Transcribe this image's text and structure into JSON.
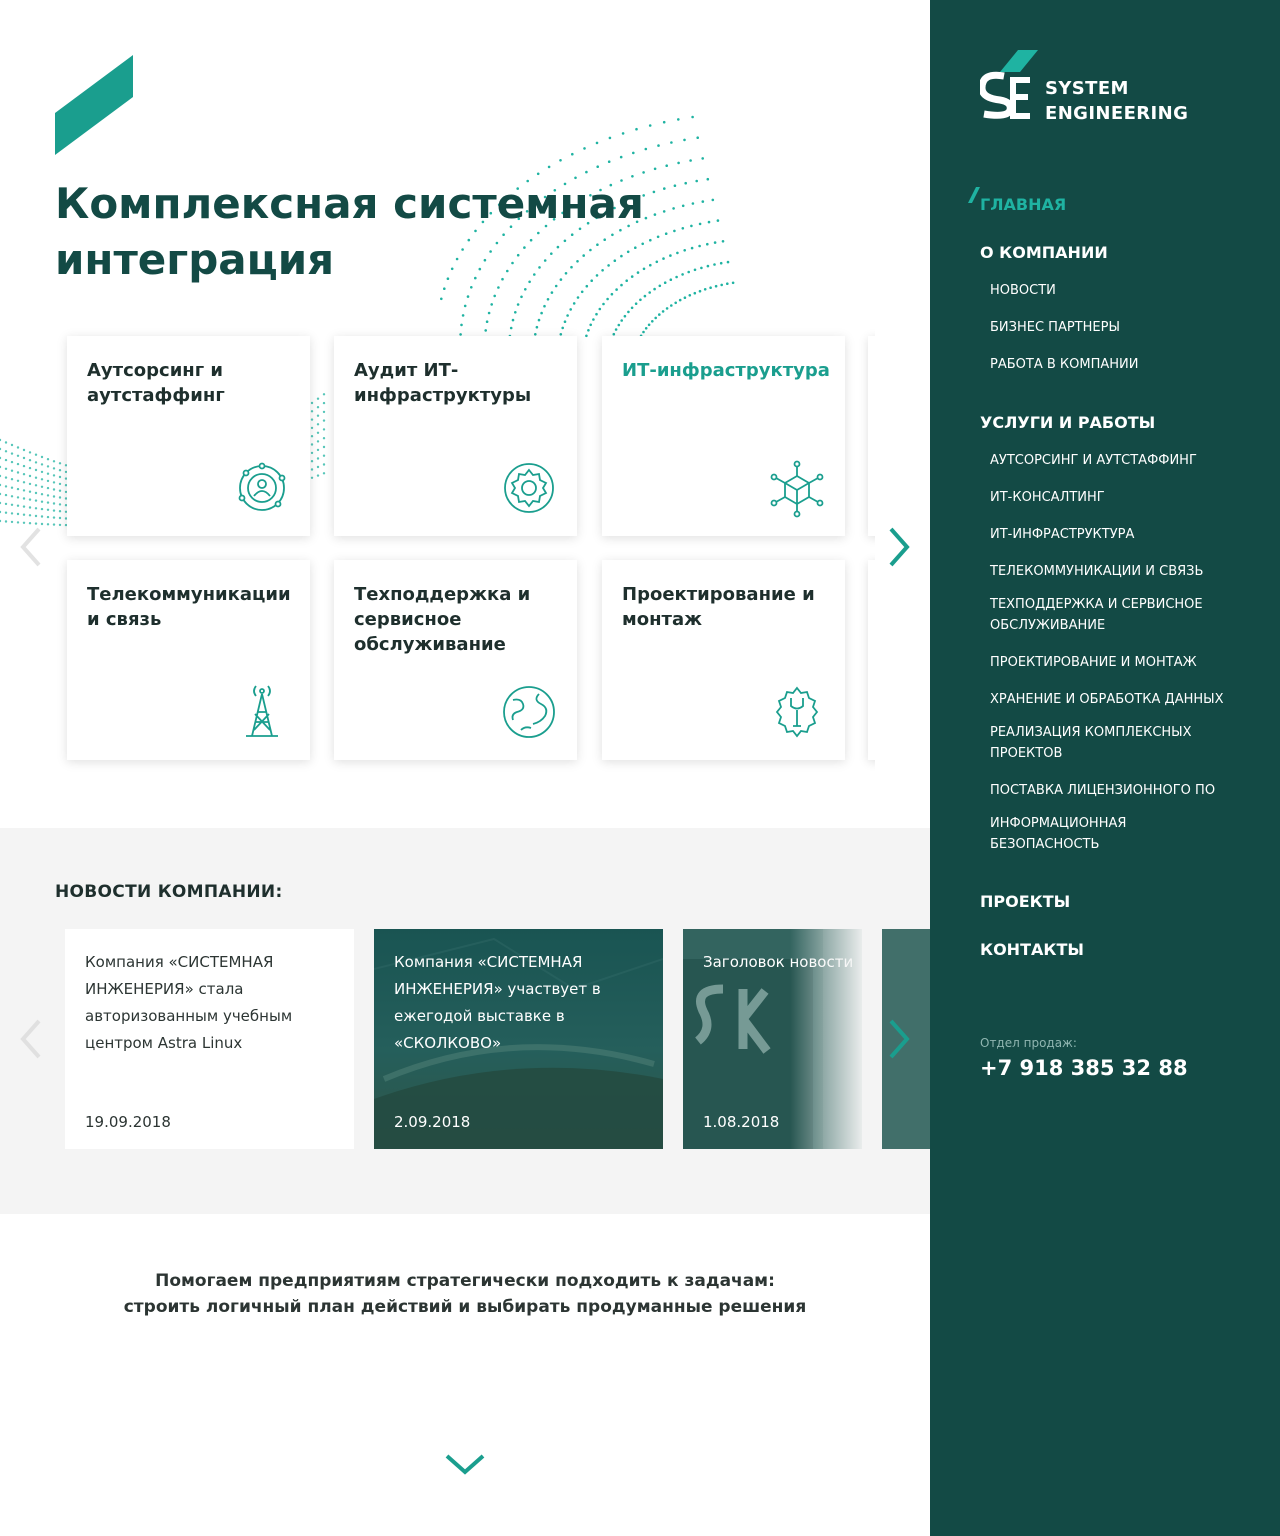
{
  "colors": {
    "brand_dark": "#134a45",
    "accent": "#1fb3a2",
    "icon": "#1a9e8e"
  },
  "brand": {
    "line1": "SYSTEM",
    "line2": "ENGINEERING",
    "logo_icon": "se-logo-icon"
  },
  "hero": {
    "title": "Комплексная системная интеграция"
  },
  "services": [
    {
      "title": "Аутсорсинг и аутстаффинг",
      "icon": "person-network-icon",
      "highlighted": false
    },
    {
      "title": "Аудит ИТ-инфраструктуры",
      "icon": "gear-icon",
      "highlighted": false
    },
    {
      "title": "ИТ-инфраструктура",
      "icon": "network-cube-icon",
      "highlighted": true
    },
    {
      "title": "Телекоммуникации и связь",
      "icon": "radio-tower-icon",
      "highlighted": false
    },
    {
      "title": "Техподдержка и сервисное обслуживание",
      "icon": "globe-support-icon",
      "highlighted": false
    },
    {
      "title": "Проектирование и монтаж",
      "icon": "wrench-gear-icon",
      "highlighted": false
    }
  ],
  "nav": {
    "home": "ГЛАВНАЯ",
    "about": "О КОМПАНИИ",
    "about_items": [
      "НОВОСТИ",
      "БИЗНЕС ПАРТНЕРЫ",
      "РАБОТА В КОМПАНИИ"
    ],
    "services": "УСЛУГИ И РАБОТЫ",
    "service_items": [
      "АУТСОРСИНГ И АУТСТАФФИНГ",
      "ИТ-КОНСАЛТИНГ",
      "ИТ-ИНФРАСТРУКТУРА",
      "ТЕЛЕКОММУНИКАЦИИ И СВЯЗЬ",
      "ТЕХПОДДЕРЖКА И СЕРВИСНОЕ ОБСЛУЖИВАНИЕ",
      "ПРОЕКТИРОВАНИЕ И МОНТАЖ",
      "ХРАНЕНИЕ И ОБРАБОТКА ДАННЫХ",
      "РЕАЛИЗАЦИЯ КОМПЛЕКСНЫХ ПРОЕКТОВ",
      "ПОСТАВКА ЛИЦЕНЗИОННОГО ПО",
      "ИНФОРМАЦИОННАЯ БЕЗОПАСНОСТЬ"
    ],
    "projects": "ПРОЕКТЫ",
    "contacts": "КОНТАКТЫ"
  },
  "sales": {
    "label": "Отдел продаж:",
    "phone": "+7 918 385 32 88"
  },
  "news": {
    "heading": "НОВОСТИ КОМПАНИИ:",
    "items": [
      {
        "text": "Компания «СИСТЕМНАЯ ИНЖЕНЕРИЯ» стала авторизованным учебным центром Astra Linux",
        "date": "19.09.2018"
      },
      {
        "text": "Компания «СИСТЕМНАЯ ИНЖЕНЕРИЯ» участвует в ежегодой выставке в «СКОЛКОВО»",
        "date": "2.09.2018"
      },
      {
        "text": "Заголовок новости",
        "date": "1.08.2018"
      }
    ]
  },
  "tagline": {
    "line1": "Помогаем предприятиям стратегически подходить к задачам:",
    "line2": "строить логичный план действий и выбирать продуманные решения"
  }
}
